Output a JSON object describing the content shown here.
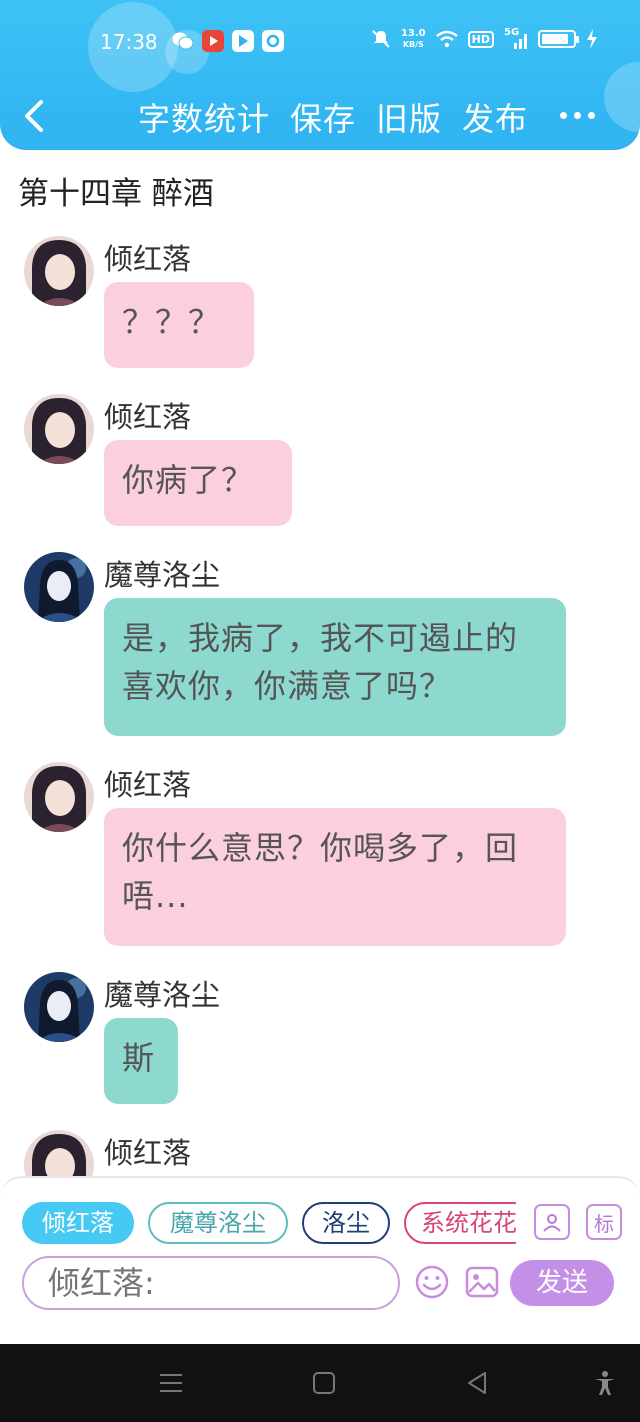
{
  "status_bar": {
    "time": "17:38",
    "net_speed_value": "13.0",
    "net_speed_unit": "KB/S",
    "hd_label": "HD",
    "signal_label": "5G",
    "battery_level": 0.85
  },
  "nav": {
    "items": [
      "字数统计",
      "保存",
      "旧版",
      "发布"
    ]
  },
  "chapter": {
    "title": "第十四章  醉酒"
  },
  "messages": [
    {
      "sender": "倾红落",
      "text": "？？？"
    },
    {
      "sender": "倾红落",
      "text": "你病了？"
    },
    {
      "sender": "魔尊洛尘",
      "text": "是，我病了，我不可遏止的喜欢你，你满意了吗？"
    },
    {
      "sender": "倾红落",
      "text": "你什么意思？你喝多了，回唔..."
    },
    {
      "sender": "魔尊洛尘",
      "text": "斯"
    },
    {
      "sender": "倾红落",
      "text": ""
    }
  ],
  "composer": {
    "chips": [
      "倾红落",
      "魔尊洛尘",
      "洛尘",
      "系统花花"
    ],
    "tag_button_label": "标",
    "input_placeholder": "倾红落:",
    "send_label": "发送"
  },
  "colors": {
    "header": "#2fb3f2",
    "pink_bubble": "#fccfdc",
    "teal_bubble": "#8dd9d0",
    "accent_purple": "#c48fe6"
  }
}
